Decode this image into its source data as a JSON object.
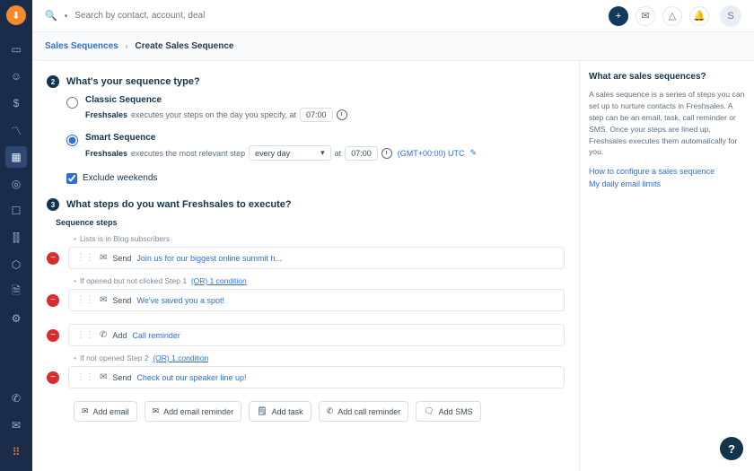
{
  "topbar": {
    "search_placeholder": "Search by contact, account, deal",
    "avatar_initial": "S"
  },
  "nav": {
    "logo_glyph": "⬇"
  },
  "breadcrumb": {
    "root": "Sales Sequences",
    "current": "Create Sales Sequence"
  },
  "section2": {
    "number": "2",
    "question": "What's your sequence type?",
    "classic": {
      "label": "Classic Sequence",
      "brand": "Freshsales",
      "desc": " executes your steps on the day you specify, at",
      "time": "07:00"
    },
    "smart": {
      "label": "Smart Sequence",
      "brand": "Freshsales",
      "desc": " executes the most relevant step",
      "freq": "every day",
      "at": "at",
      "time": "07:00",
      "tz": "(GMT+00:00) UTC",
      "tzedit": "✎"
    },
    "exclude_label": "Exclude weekends"
  },
  "section3": {
    "number": "3",
    "question": "What steps do you want Freshsales to execute?",
    "steps_header": "Sequence steps",
    "cond1": {
      "prefix": "Lists is in Blog subscribers"
    },
    "step1": {
      "verb": "Send",
      "link": "Join us for our biggest online summit h..."
    },
    "cond2": {
      "prefix": "If opened but not clicked Step 1",
      "link": "(OR) 1 condition"
    },
    "step2": {
      "verb": "Send",
      "link": "We've saved you a spot!"
    },
    "step3": {
      "verb": "Add",
      "link": "Call reminder"
    },
    "cond3": {
      "prefix": "If not opened Step 2",
      "link": "(OR) 1 condition"
    },
    "step4": {
      "verb": "Send",
      "link": "Check out our speaker line up!"
    },
    "add": {
      "email": "Add email",
      "email_reminder": "Add email reminder",
      "task": "Add task",
      "call": "Add call reminder",
      "sms": "Add SMS"
    }
  },
  "help": {
    "title": "What are sales sequences?",
    "desc": "A sales sequence is a series of steps you can set up to nurture contacts in Freshsales. A step can be an email, task, call reminder or SMS. Once your steps are lined up, Freshsales executes them automatically for you.",
    "link1": "How to configure a sales sequence",
    "link2": "My daily email limits"
  }
}
